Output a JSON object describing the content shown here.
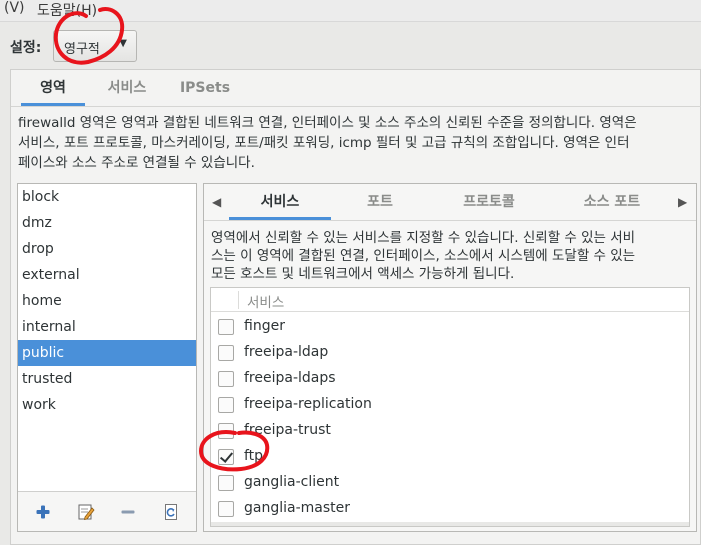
{
  "menubar": {
    "view_fragment": "(V)",
    "help": "도움말(H)"
  },
  "config": {
    "label": "설정:",
    "value": "영구적"
  },
  "main_tabs": [
    {
      "label": "영역",
      "active": true
    },
    {
      "label": "서비스",
      "active": false
    },
    {
      "label": "IPSets",
      "active": false
    }
  ],
  "description": [
    "firewalld 영역은 영역과 결합된 네트워크 연결, 인터페이스 및 소스 주소의 신뢰된 수준을 정의합니다. 영역은",
    "서비스, 포트 프로토콜, 마스커레이딩, 포트/패킷 포워딩, icmp 필터 및 고급 규칙의 조합입니다. 영역은 인터",
    "페이스와 소스 주소로 연결될 수 있습니다."
  ],
  "zones": [
    {
      "name": "block",
      "selected": false
    },
    {
      "name": "dmz",
      "selected": false
    },
    {
      "name": "drop",
      "selected": false
    },
    {
      "name": "external",
      "selected": false
    },
    {
      "name": "home",
      "selected": false
    },
    {
      "name": "internal",
      "selected": false
    },
    {
      "name": "public",
      "selected": true
    },
    {
      "name": "trusted",
      "selected": false
    },
    {
      "name": "work",
      "selected": false
    }
  ],
  "zone_tools": [
    "add-icon",
    "edit-icon",
    "remove-icon",
    "reload-icon"
  ],
  "sub_tabs": [
    {
      "label": "서비스",
      "active": true
    },
    {
      "label": "포트",
      "active": false
    },
    {
      "label": "프로토콜",
      "active": false
    },
    {
      "label": "소스 포트",
      "active": false
    }
  ],
  "services_description": [
    "영역에서 신뢰할 수 있는 서비스를 지정할 수 있습니다. 신뢰할 수 있는 서비",
    "스는 이 영역에 결합된 연결, 인터페이스, 소스에서 시스템에 도달할 수 있는",
    "모든 호스트 및 네트워크에서 액세스 가능하게 됩니다."
  ],
  "services_header": "서비스",
  "services": [
    {
      "name": "finger",
      "checked": false
    },
    {
      "name": "freeipa-ldap",
      "checked": false
    },
    {
      "name": "freeipa-ldaps",
      "checked": false
    },
    {
      "name": "freeipa-replication",
      "checked": false
    },
    {
      "name": "freeipa-trust",
      "checked": false
    },
    {
      "name": "ftp",
      "checked": true
    },
    {
      "name": "ganglia-client",
      "checked": false
    },
    {
      "name": "ganglia-master",
      "checked": false
    }
  ],
  "colors": {
    "selection": "#4a90d9",
    "annotation": "#e8141c"
  }
}
